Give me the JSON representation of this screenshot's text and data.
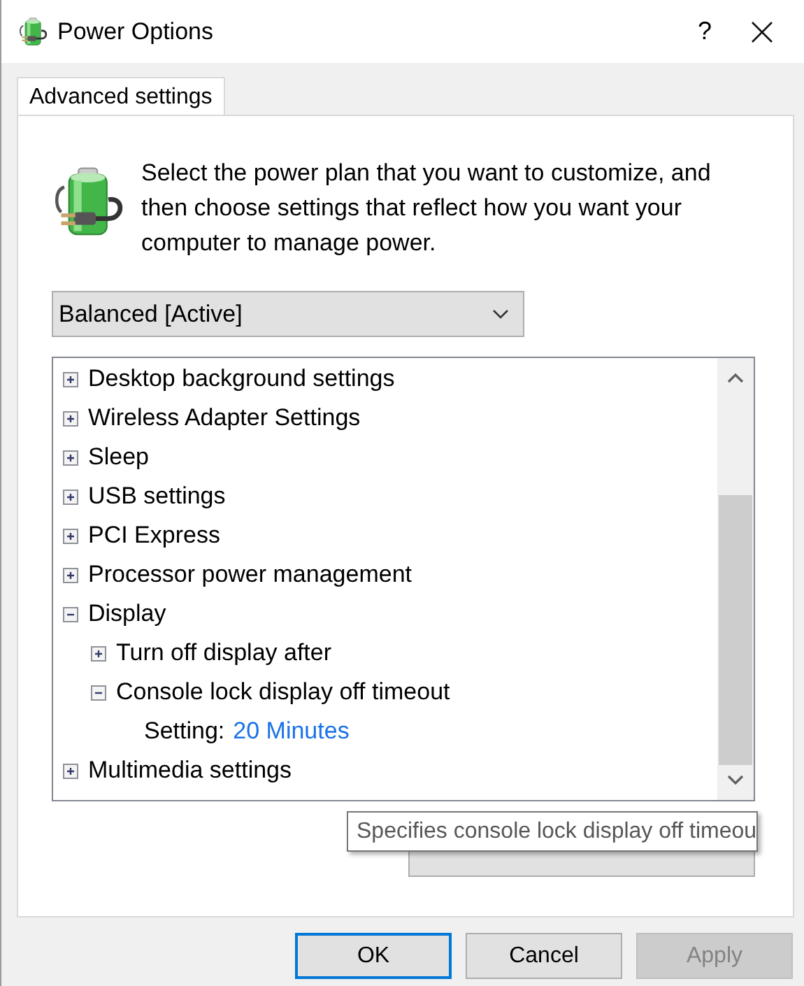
{
  "window": {
    "title": "Power Options",
    "help": "?"
  },
  "tabs": [
    {
      "label": "Advanced settings",
      "selected": true
    }
  ],
  "description": "Select the power plan that you want to customize, and then choose settings that reflect how you want your computer to manage power.",
  "plan_dropdown": {
    "value": "Balanced [Active]"
  },
  "settings_tree": [
    {
      "kind": "group",
      "label": "Desktop background settings",
      "expanded": false
    },
    {
      "kind": "group",
      "label": "Wireless Adapter Settings",
      "expanded": false
    },
    {
      "kind": "group",
      "label": "Sleep",
      "expanded": false
    },
    {
      "kind": "group",
      "label": "USB settings",
      "expanded": false
    },
    {
      "kind": "group",
      "label": "PCI Express",
      "expanded": false
    },
    {
      "kind": "group",
      "label": "Processor power management",
      "expanded": false
    },
    {
      "kind": "group",
      "label": "Display",
      "expanded": true,
      "children": [
        {
          "kind": "group",
          "label": "Turn off display after",
          "expanded": false
        },
        {
          "kind": "group",
          "label": "Console lock display off timeout",
          "expanded": true,
          "children": [
            {
              "kind": "setting",
              "label": "Setting:",
              "value": "20 Minutes"
            }
          ]
        }
      ]
    },
    {
      "kind": "group",
      "label": "Multimedia settings",
      "expanded": false
    }
  ],
  "tooltip": "Specifies console lock display off timeou",
  "buttons": [
    {
      "label": "OK",
      "kind": "default",
      "disabled": false
    },
    {
      "label": "Cancel",
      "kind": "normal",
      "disabled": false
    },
    {
      "label": "Apply",
      "kind": "normal",
      "disabled": true
    }
  ]
}
